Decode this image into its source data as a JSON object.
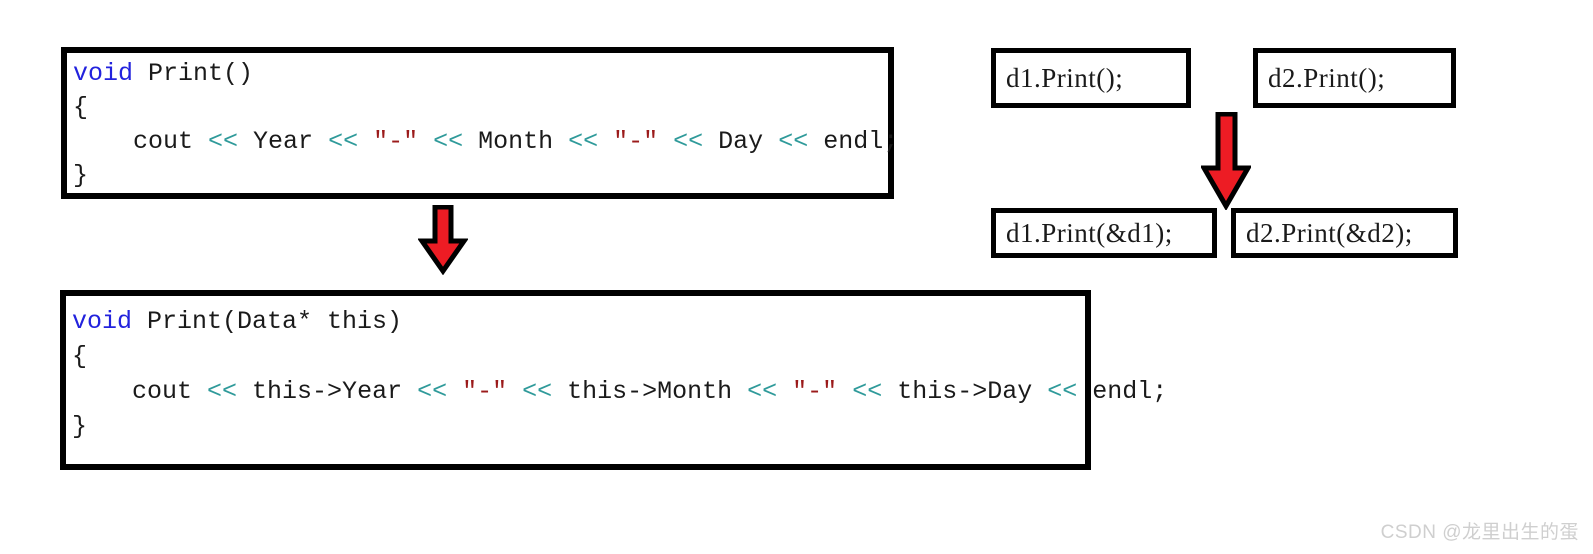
{
  "page": {
    "background": "#ffffff",
    "watermark": "CSDN @龙里出生的蛋"
  },
  "colors": {
    "keyword": "#2222dd",
    "operator": "#2f9a9a",
    "string": "#9b1a1a",
    "plain": "#1a1a1a",
    "border": "#000000",
    "arrow_fill": "#ed1c24",
    "arrow_outline": "#000000",
    "watermark": "#cfcfcf"
  },
  "code_block_1": {
    "name": "Print-without-this",
    "line1": {
      "keyword": "void",
      "rest": " Print()"
    },
    "line2": "{",
    "line3": {
      "indent": "    ",
      "cout": "cout",
      "op1": " << ",
      "t1": "Year",
      "op2": " << ",
      "s1": "\"-\"",
      "op3": " << ",
      "t2": "Month",
      "op4": " << ",
      "s2": "\"-\"",
      "op5": " << ",
      "t3": "Day",
      "op6": " << ",
      "t4": "endl;"
    },
    "line4": "}"
  },
  "code_block_2": {
    "name": "Print-with-this",
    "line1": {
      "keyword": "void",
      "rest": " Print(Data* this)"
    },
    "line2": "{",
    "line3": {
      "indent": "    ",
      "cout": "cout",
      "op1": " << ",
      "t1": "this->Year",
      "op2": " << ",
      "s1": "\"-\"",
      "op3": " << ",
      "t2": "this->Month",
      "op4": " << ",
      "s2": "\"-\"",
      "op5": " << ",
      "t3": "this->Day",
      "op6": " << ",
      "t4": "endl;"
    },
    "line4": "}"
  },
  "call_boxes": {
    "d1_print": "d1.Print();",
    "d2_print": "d2.Print();",
    "d1_print_addr": "d1.Print(&d1);",
    "d2_print_addr": "d2.Print(&d2);"
  },
  "arrows": [
    {
      "id": "arrow-down-left",
      "direction": "down",
      "meaning": "transforms-to"
    },
    {
      "id": "arrow-down-right",
      "direction": "down",
      "meaning": "transforms-to"
    }
  ]
}
